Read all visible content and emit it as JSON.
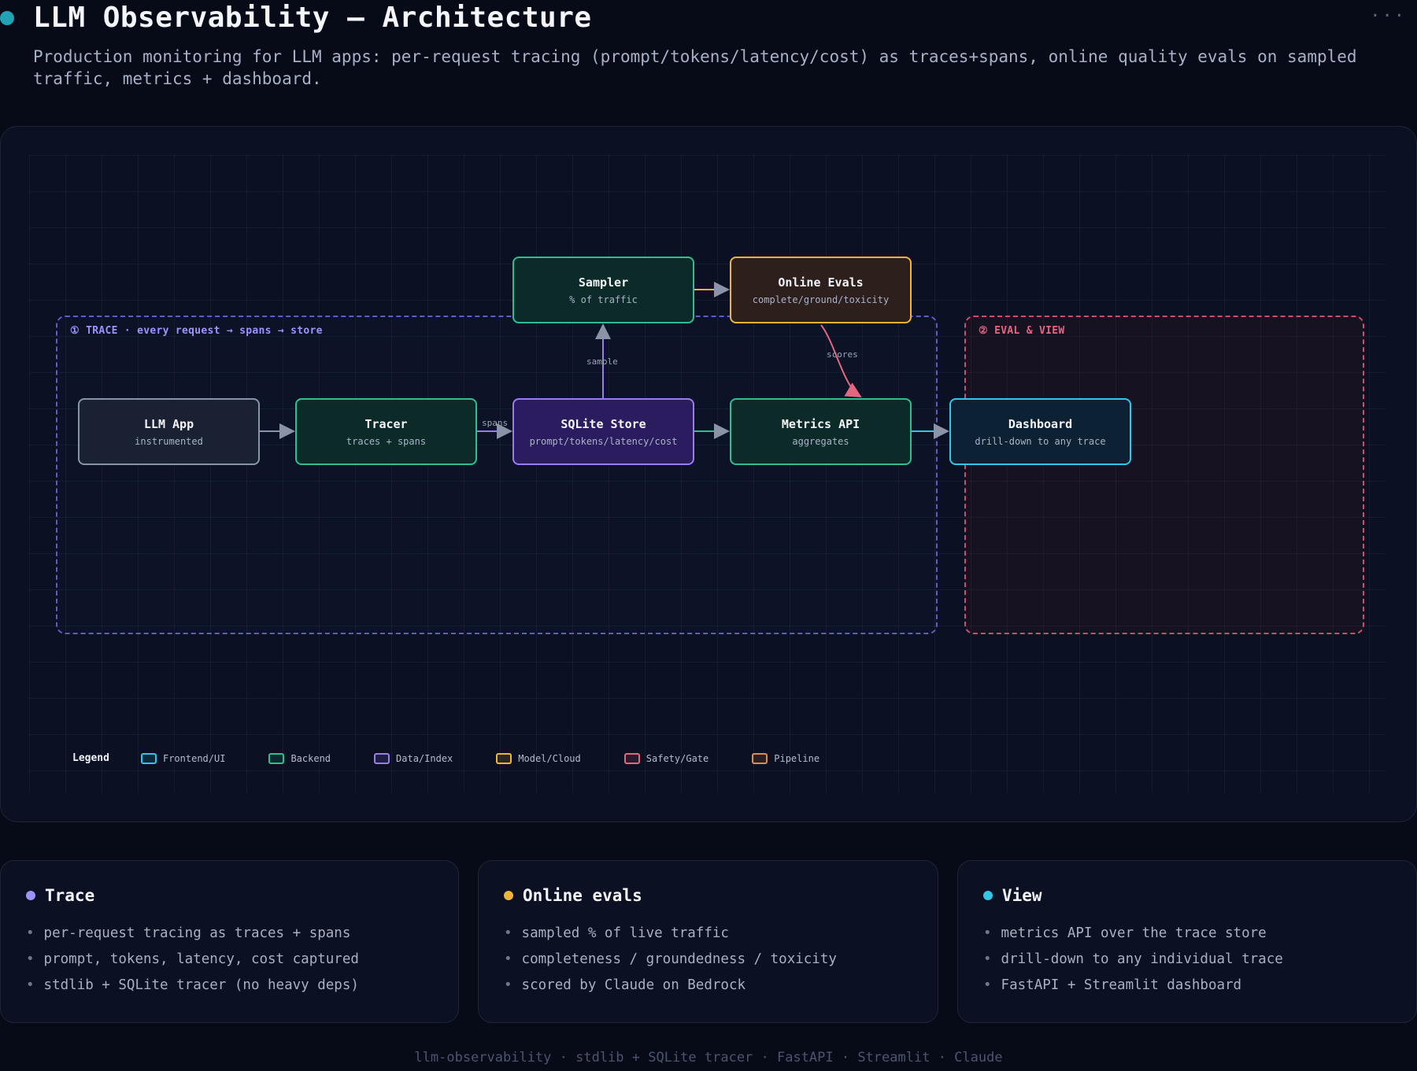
{
  "header": {
    "title": "LLM Observability — Architecture",
    "subtitle": "Production monitoring for LLM apps: per-request tracing (prompt/tokens/latency/cost) as traces+spans, online quality evals on sampled traffic, metrics + dashboard.",
    "more_icon": "more-dots-icon",
    "dot_color": "#22a3b5"
  },
  "diagram": {
    "groups": {
      "trace": {
        "label": "① TRACE · every request → spans → store",
        "color": "#5f5cc7"
      },
      "eval": {
        "label": "② EVAL & VIEW",
        "color": "#c9506a"
      }
    },
    "nodes": {
      "llm_app": {
        "title": "LLM App",
        "sub": "instrumented"
      },
      "tracer": {
        "title": "Tracer",
        "sub": "traces + spans"
      },
      "sqlite_store": {
        "title": "SQLite Store",
        "sub": "prompt/tokens/latency/cost"
      },
      "metrics_api": {
        "title": "Metrics API",
        "sub": "aggregates"
      },
      "dashboard": {
        "title": "Dashboard",
        "sub": "drill-down to any trace"
      },
      "sampler": {
        "title": "Sampler",
        "sub": "% of traffic"
      },
      "online_evals": {
        "title": "Online Evals",
        "sub": "complete/ground/toxicity"
      }
    },
    "edges": {
      "spans": "spans",
      "sample": "sample",
      "scores": "scores"
    },
    "legend": {
      "title": "Legend",
      "items": [
        {
          "label": "Frontend/UI",
          "color": "#34c6e6"
        },
        {
          "label": "Backend",
          "color": "#2fbf8f"
        },
        {
          "label": "Data/Index",
          "color": "#9a7cf0"
        },
        {
          "label": "Model/Cloud",
          "color": "#f0b43a"
        },
        {
          "label": "Safety/Gate",
          "color": "#e4667f"
        },
        {
          "label": "Pipeline",
          "color": "#e08a4a"
        }
      ]
    }
  },
  "cards": {
    "trace": {
      "title": "Trace",
      "color": "#9c93ff",
      "items": [
        "per-request tracing as traces + spans",
        "prompt, tokens, latency, cost captured",
        "stdlib + SQLite tracer (no heavy deps)"
      ]
    },
    "evals": {
      "title": "Online evals",
      "color": "#f0b43a",
      "items": [
        "sampled % of live traffic",
        "completeness / groundedness / toxicity",
        "scored by Claude on Bedrock"
      ]
    },
    "view": {
      "title": "View",
      "color": "#34c6e6",
      "items": [
        "metrics API over the trace store",
        "drill-down to any individual trace",
        "FastAPI + Streamlit dashboard"
      ]
    }
  },
  "footer": "llm-observability · stdlib + SQLite tracer · FastAPI · Streamlit · Claude"
}
